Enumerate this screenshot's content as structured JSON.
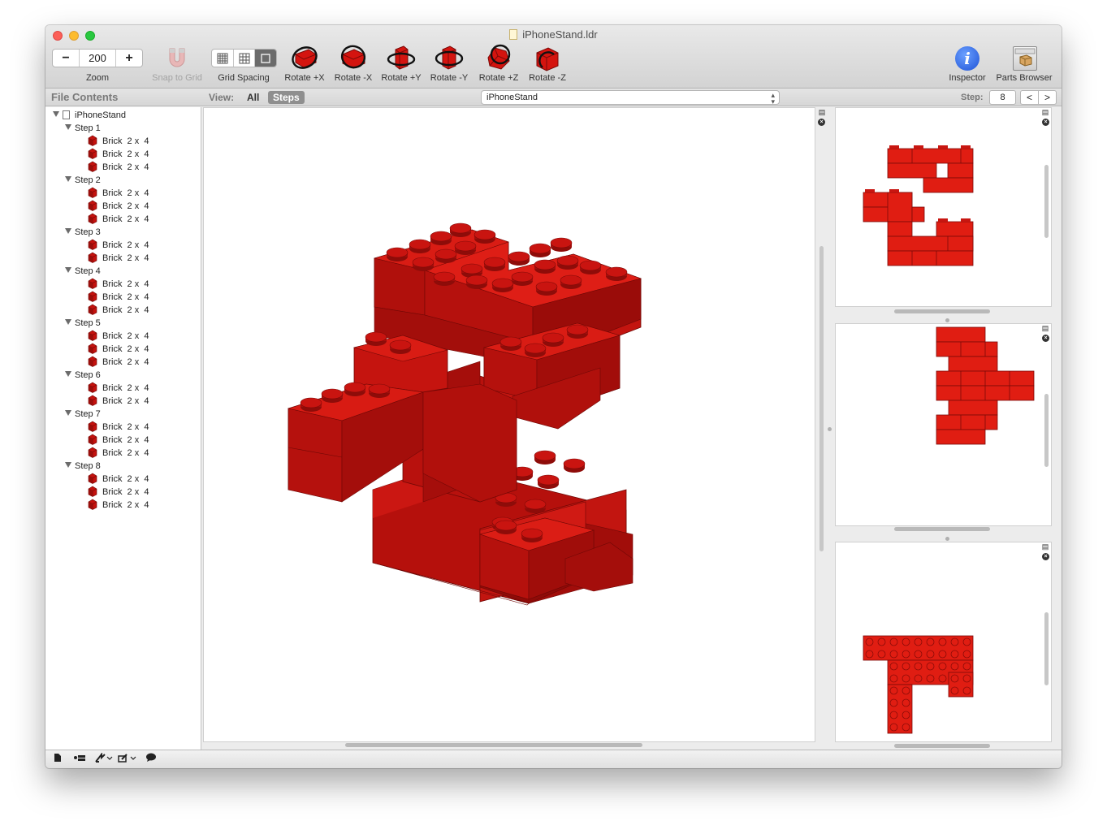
{
  "window": {
    "title": "iPhoneStand.ldr"
  },
  "toolbar": {
    "zoom": {
      "decrement": "−",
      "value": "200",
      "increment": "+",
      "label": "Zoom"
    },
    "snap_label": "Snap to Grid",
    "grid_label": "Grid Spacing",
    "rotate_buttons": [
      {
        "label": "Rotate +X",
        "icon": "rotate-plus-x-icon"
      },
      {
        "label": "Rotate -X",
        "icon": "rotate-minus-x-icon"
      },
      {
        "label": "Rotate +Y",
        "icon": "rotate-plus-y-icon"
      },
      {
        "label": "Rotate -Y",
        "icon": "rotate-minus-y-icon"
      },
      {
        "label": "Rotate +Z",
        "icon": "rotate-plus-z-icon"
      },
      {
        "label": "Rotate -Z",
        "icon": "rotate-minus-z-icon"
      }
    ],
    "inspector_label": "Inspector",
    "inspector_glyph": "i",
    "parts_browser_label": "Parts Browser"
  },
  "subbar": {
    "file_contents_title": "File Contents",
    "view_label": "View:",
    "view_all": "All",
    "view_steps": "Steps",
    "model_select": "iPhoneStand",
    "step_label": "Step:",
    "step_value": "8",
    "prev": "<",
    "next": ">"
  },
  "tree": {
    "root": "iPhoneStand",
    "steps": [
      {
        "label": "Step 1",
        "parts": [
          "Brick  2 x  4",
          "Brick  2 x  4",
          "Brick  2 x  4"
        ]
      },
      {
        "label": "Step 2",
        "parts": [
          "Brick  2 x  4",
          "Brick  2 x  4",
          "Brick  2 x  4"
        ]
      },
      {
        "label": "Step 3",
        "parts": [
          "Brick  2 x  4",
          "Brick  2 x  4"
        ]
      },
      {
        "label": "Step 4",
        "parts": [
          "Brick  2 x  4",
          "Brick  2 x  4",
          "Brick  2 x  4"
        ]
      },
      {
        "label": "Step 5",
        "parts": [
          "Brick  2 x  4",
          "Brick  2 x  4",
          "Brick  2 x  4"
        ]
      },
      {
        "label": "Step 6",
        "parts": [
          "Brick  2 x  4",
          "Brick  2 x  4"
        ]
      },
      {
        "label": "Step 7",
        "parts": [
          "Brick  2 x  4",
          "Brick  2 x  4",
          "Brick  2 x  4"
        ]
      },
      {
        "label": "Step 8",
        "parts": [
          "Brick  2 x  4",
          "Brick  2 x  4",
          "Brick  2 x  4"
        ]
      }
    ]
  },
  "colors": {
    "brick_red": "#c4120e",
    "brick_red_dark": "#9a0e0b",
    "brick_red_light": "#e01d12",
    "accent_blue": "#1f52d6"
  }
}
